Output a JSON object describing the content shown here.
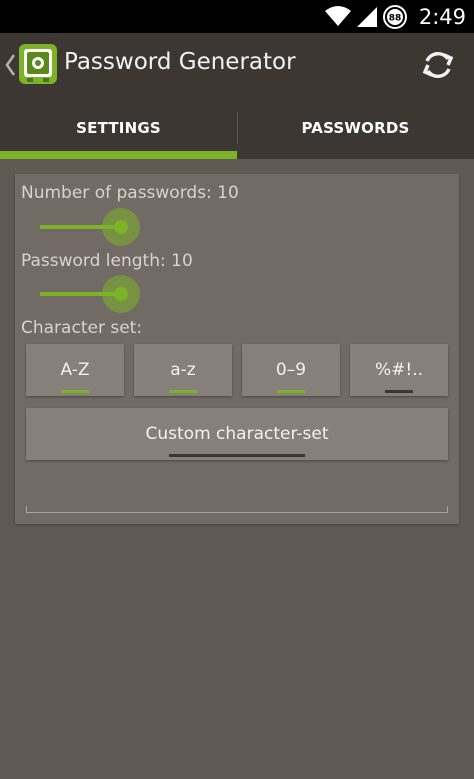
{
  "status_bar": {
    "time": "2:49",
    "battery_level": "88"
  },
  "action_bar": {
    "title": "Password Generator",
    "app_icon": "safe-icon",
    "refresh_icon": "refresh-icon"
  },
  "tabs": [
    {
      "label": "SETTINGS",
      "selected": true
    },
    {
      "label": "PASSWORDS",
      "selected": false
    }
  ],
  "settings": {
    "number_of_passwords": {
      "label": "Number of passwords: 10",
      "value": 10
    },
    "password_length": {
      "label": "Password length: 10",
      "value": 10
    },
    "character_set": {
      "label": "Character set:",
      "options": [
        {
          "label": "A-Z",
          "enabled": true
        },
        {
          "label": "a-z",
          "enabled": true
        },
        {
          "label": "0–9",
          "enabled": true
        },
        {
          "label": "%#!..",
          "enabled": false
        }
      ],
      "custom_button_label": "Custom character-set",
      "custom_enabled": false
    },
    "custom_charset_value": ""
  },
  "colors": {
    "accent": "#7cb228",
    "background": "#5f5853",
    "action_bar": "#3c3733",
    "panel": "#716a65",
    "button": "#86807b"
  }
}
